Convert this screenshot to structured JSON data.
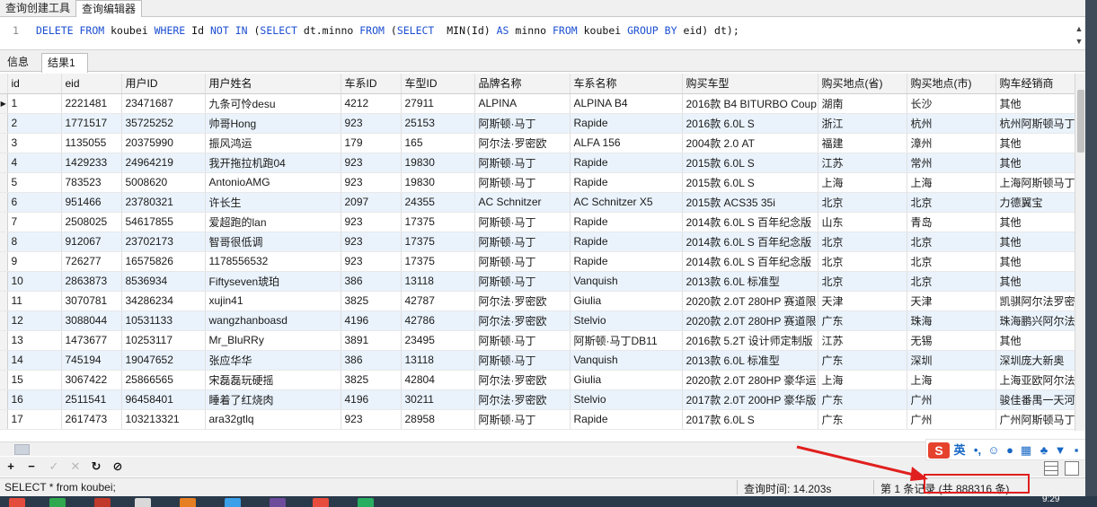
{
  "top_tabs": [
    "查询创建工具",
    "查询编辑器"
  ],
  "editor": {
    "line_no": "1",
    "sql": {
      "p1": "DELETE",
      "p2": "FROM",
      "p3": "koubei",
      "p4": "WHERE",
      "p5": "Id",
      "p6": "NOT",
      "p7": "IN",
      "p8": "(",
      "p9": "SELECT",
      "p10": "dt.minno",
      "p11": "FROM",
      "p12": "(",
      "p13": "SELECT",
      "p14": "MIN(Id)",
      "p15": "AS",
      "p16": "minno",
      "p17": "FROM",
      "p18": "koubei",
      "p19": "GROUP BY",
      "p20": "eid) dt);"
    }
  },
  "result_tabs": [
    "信息",
    "结果1"
  ],
  "grid": {
    "columns": [
      "id",
      "eid",
      "用户ID",
      "用户姓名",
      "车系ID",
      "车型ID",
      "品牌名称",
      "车系名称",
      "购买车型",
      "购买地点(省)",
      "购买地点(市)",
      "购车经销商"
    ],
    "rows": [
      [
        "1",
        "2221481",
        "23471687",
        "九条可怜desu",
        "4212",
        "27911",
        "ALPINA",
        "ALPINA B4",
        "2016款 B4 BITURBO Coup",
        "湖南",
        "长沙",
        "其他"
      ],
      [
        "2",
        "1771517",
        "35725252",
        "帅哥Hong",
        "923",
        "25153",
        "阿斯顿·马丁",
        "Rapide",
        "2016款 6.0L S",
        "浙江",
        "杭州",
        "杭州阿斯顿马丁"
      ],
      [
        "3",
        "1135055",
        "20375990",
        "振风鸿运",
        "179",
        "165",
        "阿尔法·罗密欧",
        "ALFA 156",
        "2004款 2.0 AT",
        "福建",
        "漳州",
        "其他"
      ],
      [
        "4",
        "1429233",
        "24964219",
        "我开拖拉机跑04",
        "923",
        "19830",
        "阿斯顿·马丁",
        "Rapide",
        "2015款 6.0L S",
        "江苏",
        "常州",
        "其他"
      ],
      [
        "5",
        "783523",
        "5008620",
        "AntonioAMG",
        "923",
        "19830",
        "阿斯顿·马丁",
        "Rapide",
        "2015款 6.0L S",
        "上海",
        "上海",
        "上海阿斯顿马丁"
      ],
      [
        "6",
        "951466",
        "23780321",
        "许长生",
        "2097",
        "24355",
        "AC Schnitzer",
        "AC Schnitzer X5",
        "2015款 ACS35 35i",
        "北京",
        "北京",
        "力德翼宝"
      ],
      [
        "7",
        "2508025",
        "54617855",
        "爱超跑的lan",
        "923",
        "17375",
        "阿斯顿·马丁",
        "Rapide",
        "2014款 6.0L S 百年纪念版",
        "山东",
        "青岛",
        "其他"
      ],
      [
        "8",
        "912067",
        "23702173",
        "智哥很低调",
        "923",
        "17375",
        "阿斯顿·马丁",
        "Rapide",
        "2014款 6.0L S 百年纪念版",
        "北京",
        "北京",
        "其他"
      ],
      [
        "9",
        "726277",
        "16575826",
        "1178556532",
        "923",
        "17375",
        "阿斯顿·马丁",
        "Rapide",
        "2014款 6.0L S 百年纪念版",
        "北京",
        "北京",
        "其他"
      ],
      [
        "10",
        "2863873",
        "8536934",
        "Fiftyseven琥珀",
        "386",
        "13118",
        "阿斯顿·马丁",
        "Vanquish",
        "2013款 6.0L 标准型",
        "北京",
        "北京",
        "其他"
      ],
      [
        "11",
        "3070781",
        "34286234",
        "xujin41",
        "3825",
        "42787",
        "阿尔法·罗密欧",
        "Giulia",
        "2020款 2.0T 280HP 赛道限",
        "天津",
        "天津",
        "凯骐阿尔法罗密"
      ],
      [
        "12",
        "3088044",
        "10531133",
        "wangzhanboasd",
        "4196",
        "42786",
        "阿尔法·罗密欧",
        "Stelvio",
        "2020款 2.0T 280HP 赛道限",
        "广东",
        "珠海",
        "珠海鹏兴阿尔法"
      ],
      [
        "13",
        "1473677",
        "10253117",
        "Mr_BluRRy",
        "3891",
        "23495",
        "阿斯顿·马丁",
        "阿斯顿·马丁DB11",
        "2016款 5.2T 设计师定制版",
        "江苏",
        "无锡",
        "其他"
      ],
      [
        "14",
        "745194",
        "19047652",
        "张应华华",
        "386",
        "13118",
        "阿斯顿·马丁",
        "Vanquish",
        "2013款 6.0L 标准型",
        "广东",
        "深圳",
        "深圳庞大新奥"
      ],
      [
        "15",
        "3067422",
        "25866565",
        "宋磊磊玩硬摇",
        "3825",
        "42804",
        "阿尔法·罗密欧",
        "Giulia",
        "2020款 2.0T 280HP 豪华运",
        "上海",
        "上海",
        "上海亚欧阿尔法"
      ],
      [
        "16",
        "2511541",
        "96458401",
        "睡着了红烧肉",
        "4196",
        "30211",
        "阿尔法·罗密欧",
        "Stelvio",
        "2017款 2.0T 200HP 豪华版",
        "广东",
        "广州",
        "骏佳番禺一天河"
      ],
      [
        "17",
        "2617473",
        "103213321",
        "ara32gtlq",
        "923",
        "28958",
        "阿斯顿·马丁",
        "Rapide",
        "2017款 6.0L S",
        "广东",
        "广州",
        "广州阿斯顿马丁"
      ]
    ]
  },
  "toolbar": {
    "add": "+",
    "remove": "−",
    "apply": "✓",
    "cancel": "✕",
    "refresh": "↻",
    "stop": "⊘"
  },
  "ime": {
    "logo": "S",
    "lang": "英",
    "icons": [
      "punct-icon",
      "emoji-icon",
      "mic-icon",
      "keyboard-icon",
      "clothes-icon",
      "shirt-icon",
      "grid-icon"
    ]
  },
  "status": {
    "sql": "SELECT * from koubei;",
    "query_time": "查询时间: 14.203s",
    "records": "第 1 条记录 (共 888316 条)"
  },
  "taskbar": {
    "clock": "9:29"
  },
  "colors": {
    "keyword": "#1c4fd1",
    "alt_row": "#eaf3fc",
    "annotation": "#e0201e"
  }
}
